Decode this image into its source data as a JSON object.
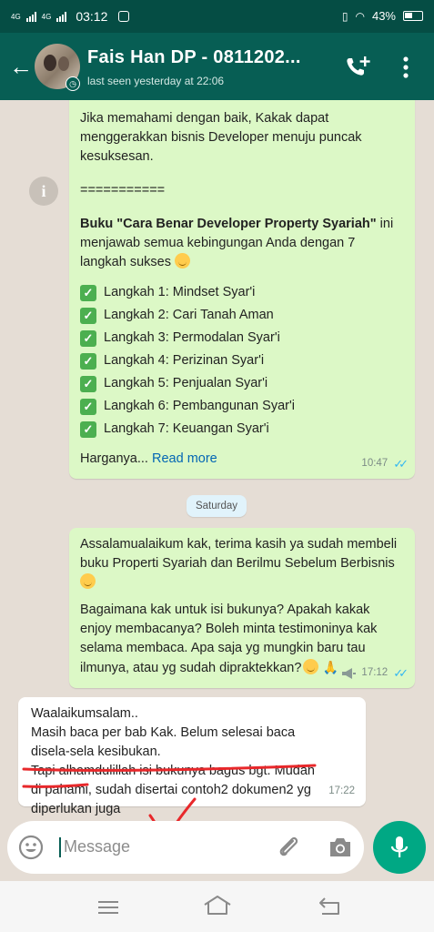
{
  "status_bar": {
    "network_1": "4G",
    "network_2": "4G",
    "time": "03:12",
    "battery": "43%"
  },
  "header": {
    "contact_name": "Fais Han DP - 0811202...",
    "last_seen": "last seen yesterday at 22:06",
    "icons": [
      "back-arrow-icon",
      "avatar",
      "add-call-icon",
      "more-vert-icon"
    ]
  },
  "messages": {
    "m1": {
      "direction": "outgoing",
      "intro": "Jika memahami dengan baik, Kakak dapat menggerakkan bisnis Developer menuju puncak kesuksesan.",
      "divider": "===========",
      "book_title": "Buku \"Cara Benar Developer Property Syariah\"",
      "book_desc": " ini menjawab semua kebingungan Anda dengan 7 langkah sukses",
      "steps": [
        "Langkah 1: Mindset Syar'i",
        "Langkah 2: Cari Tanah Aman",
        "Langkah 3: Permodalan Syar'i",
        "Langkah 4: Perizinan Syar'i",
        "Langkah 5: Penjualan Syar'i",
        "Langkah 6: Pembangunan Syar'i",
        "Langkah 7: Keuangan Syar'i"
      ],
      "price_text": "Harganya...",
      "read_more": "Read more",
      "time": "10:47"
    },
    "date_separator": "Saturday",
    "m2": {
      "direction": "outgoing",
      "para1": "Assalamualaikum kak, terima kasih ya sudah membeli buku Properti Syariah dan Berilmu Sebelum Berbisnis",
      "para2": "Bagaimana kak untuk isi bukunya? Apakah kakak enjoy membacanya? Boleh minta testimoninya kak selama membaca. Apa saja yg mungkin baru tau ilmunya, atau yg sudah dipraktekkan?",
      "time": "17:12"
    },
    "m3": {
      "direction": "incoming",
      "line1": "Waalaikumsalam..",
      "line2": "Masih baca per bab Kak. Belum selesai baca",
      "line3": "disela-sela kesibukan.",
      "line4": "Tapi alhamdulillah isi bukunya bagus bgt. Mudah",
      "line5": "di pahami, sudah disertai contoh2 dokumen2 yg",
      "line6": "diperlukan juga",
      "time": "17:22"
    }
  },
  "input": {
    "placeholder": "Message"
  },
  "colors": {
    "header": "#075e54",
    "outgoing_bubble": "#dcf8c6",
    "incoming_bubble": "#ffffff",
    "chat_bg": "#e5ddd5",
    "read_ticks": "#34b7f1",
    "fab": "#00a884",
    "annotation": "#e8282b"
  }
}
